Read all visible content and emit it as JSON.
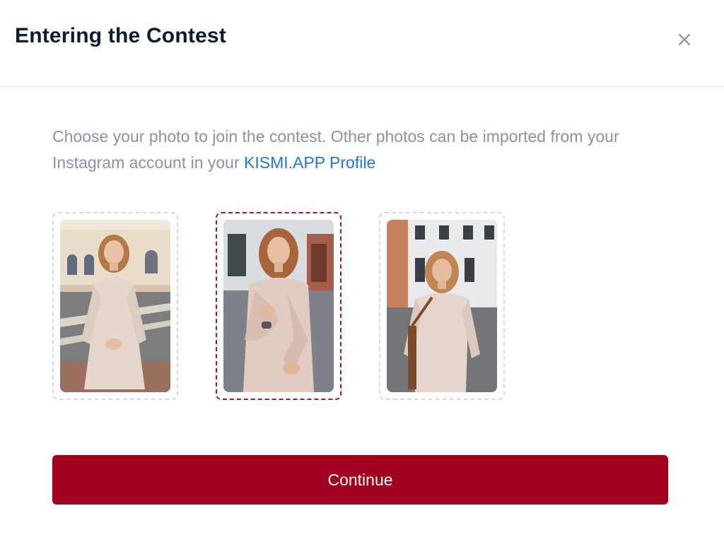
{
  "modal": {
    "title": "Entering the Contest",
    "close_icon": "close-icon"
  },
  "intro": {
    "text": "Choose your photo to join the contest. Other photos can be imported from your Instagram account in your ",
    "link_label": "KISMI.APP Profile"
  },
  "photos": [
    {
      "selected": false
    },
    {
      "selected": true
    },
    {
      "selected": false
    }
  ],
  "colors": {
    "accent": "#a1001e",
    "selected_border": "#b0142a",
    "link": "#1f78d9",
    "muted_text": "#8a93a5",
    "title_text": "#0c1a33"
  },
  "continue_button": {
    "label": "Continue"
  }
}
